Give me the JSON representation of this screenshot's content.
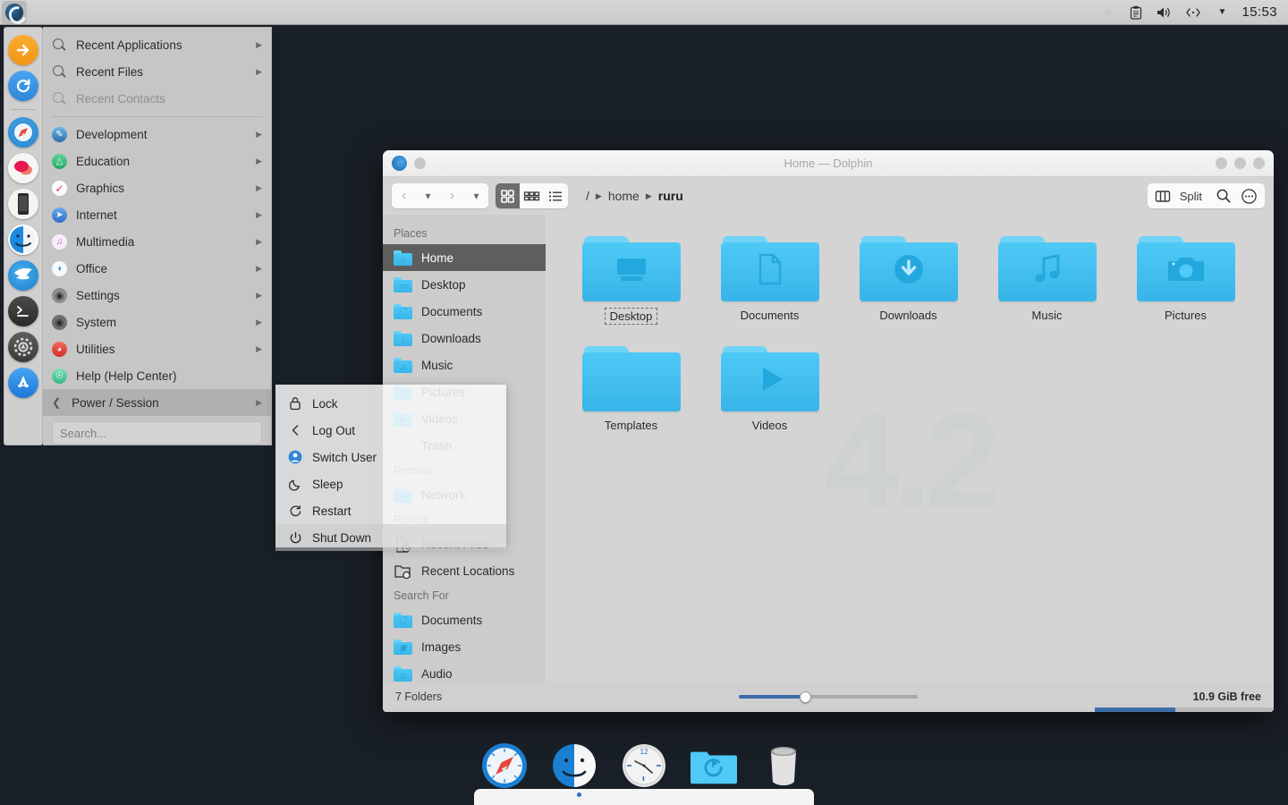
{
  "panel": {
    "launcher_icon": "openmandriva-logo-icon",
    "tray": [
      {
        "name": "bluetooth-disabled-icon",
        "glyph": "○"
      },
      {
        "name": "clipboard-icon",
        "glyph": "📋"
      },
      {
        "name": "volume-icon",
        "glyph": "🔊"
      },
      {
        "name": "network-icon",
        "glyph": "‹··›"
      },
      {
        "name": "show-hidden-icons-icon",
        "glyph": "▼"
      }
    ],
    "clock": "15:53"
  },
  "launcher_strip": {
    "items": [
      {
        "name": "launch-arrow-icon",
        "label": "Run"
      },
      {
        "name": "refresh-icon",
        "label": "Refresh"
      },
      {
        "name": "safari-browser-icon",
        "label": "Browser"
      },
      {
        "name": "messages-icon",
        "label": "Messages"
      },
      {
        "name": "phone-icon",
        "label": "Phone"
      },
      {
        "name": "finder-icon",
        "label": "Files"
      },
      {
        "name": "falkon-icon",
        "label": "Falkon"
      },
      {
        "name": "terminal-icon",
        "label": "Terminal"
      },
      {
        "name": "settings-gear-icon",
        "label": "Settings"
      },
      {
        "name": "app-store-icon",
        "label": "Software"
      }
    ]
  },
  "app_menu": {
    "recent": [
      {
        "label": "Recent Applications",
        "icon": "search-icon",
        "enabled": true,
        "submenu": true
      },
      {
        "label": "Recent Files",
        "icon": "search-icon",
        "enabled": true,
        "submenu": true
      },
      {
        "label": "Recent Contacts",
        "icon": "search-icon",
        "enabled": false,
        "submenu": false
      }
    ],
    "categories": [
      {
        "label": "Development",
        "icon": "development-icon",
        "color": "#3c7fc4",
        "glyph": "✐",
        "submenu": true
      },
      {
        "label": "Education",
        "icon": "education-icon",
        "color": "#3cb878",
        "glyph": "🎓",
        "submenu": true
      },
      {
        "label": "Graphics",
        "icon": "graphics-icon",
        "color": "#ffffff",
        "glyph": "✓",
        "submenu": true
      },
      {
        "label": "Internet",
        "icon": "internet-icon",
        "color": "#4a90e2",
        "glyph": "➤",
        "submenu": true
      },
      {
        "label": "Multimedia",
        "icon": "multimedia-icon",
        "color": "#f3e9f7",
        "glyph": "♫",
        "submenu": true
      },
      {
        "label": "Office",
        "icon": "office-icon",
        "color": "#ffffff",
        "glyph": "◗",
        "submenu": true
      },
      {
        "label": "Settings",
        "icon": "settings-icon",
        "color": "#6e6e6e",
        "glyph": "◎",
        "submenu": true
      },
      {
        "label": "System",
        "icon": "system-icon",
        "color": "#5a5a5a",
        "glyph": "◎",
        "submenu": true
      },
      {
        "label": "Utilities",
        "icon": "utilities-icon",
        "color": "#e8453c",
        "glyph": "⌕",
        "submenu": true
      },
      {
        "label": "Help (Help Center)",
        "icon": "help-icon",
        "color": "#4ecb9a",
        "glyph": "?",
        "submenu": false
      },
      {
        "label": "Power / Session",
        "icon": "power-session-icon",
        "color": "#777777",
        "glyph": "⏻",
        "submenu": true,
        "selected": true,
        "back": true
      }
    ],
    "search_placeholder": "Search..."
  },
  "power_submenu": {
    "items": [
      {
        "label": "Lock",
        "icon": "padlock-icon",
        "glyph": "🔒",
        "selected": false
      },
      {
        "label": "Log Out",
        "icon": "logout-chevron-icon",
        "glyph": "‹",
        "selected": false
      },
      {
        "label": "Switch User",
        "icon": "switch-user-icon",
        "glyph": "👤",
        "selected": false
      },
      {
        "label": "Sleep",
        "icon": "moon-sleep-icon",
        "glyph": "☽",
        "selected": false
      },
      {
        "label": "Restart",
        "icon": "restart-icon",
        "glyph": "↺",
        "selected": false
      },
      {
        "label": "Shut Down",
        "icon": "power-icon",
        "glyph": "⏻",
        "selected": true
      }
    ]
  },
  "dolphin": {
    "title": "Home — Dolphin",
    "window_controls": [
      "minimize",
      "maximize",
      "close"
    ],
    "toolbar": {
      "back_label": "‹",
      "back_menu_label": "▾",
      "forward_label": "›",
      "forward_menu_label": "▾",
      "view_icons_label": "▦",
      "view_compact_label": "▤",
      "view_details_label": "☰",
      "split_label": "Split",
      "search_label": "🔍",
      "menu_label": "⋯"
    },
    "breadcrumb": {
      "root": "/",
      "parts": [
        "home",
        "ruru"
      ]
    },
    "places": {
      "sections": [
        {
          "header": "Places",
          "items": [
            {
              "label": "Home",
              "icon": "folder-home-icon",
              "glyph": "⌂",
              "selected": true
            },
            {
              "label": "Desktop",
              "icon": "folder-desktop-icon",
              "glyph": "▭",
              "selected": false
            },
            {
              "label": "Documents",
              "icon": "folder-documents-icon",
              "glyph": "☰",
              "selected": false
            },
            {
              "label": "Downloads",
              "icon": "folder-downloads-icon",
              "glyph": "↓",
              "selected": false
            },
            {
              "label": "Music",
              "icon": "folder-music-icon",
              "glyph": "♫",
              "selected": false
            },
            {
              "label": "Pictures",
              "icon": "folder-pictures-icon",
              "glyph": "▣",
              "selected": false
            },
            {
              "label": "Videos",
              "icon": "folder-videos-icon",
              "glyph": "▶",
              "selected": false
            },
            {
              "label": "Trash",
              "icon": "trash-icon",
              "glyph": "🗑",
              "selected": false
            }
          ]
        },
        {
          "header": "Remote",
          "items": [
            {
              "label": "Network",
              "icon": "folder-network-icon",
              "glyph": "☁",
              "selected": false
            }
          ]
        },
        {
          "header": "Recent",
          "items": [
            {
              "label": "Recent Files",
              "icon": "recent-files-icon",
              "glyph": "⏱",
              "selected": false
            },
            {
              "label": "Recent Locations",
              "icon": "recent-locations-icon",
              "glyph": "⏱",
              "selected": false
            }
          ]
        },
        {
          "header": "Search For",
          "items": [
            {
              "label": "Documents",
              "icon": "search-documents-icon",
              "glyph": "☰",
              "selected": false
            },
            {
              "label": "Images",
              "icon": "search-images-icon",
              "glyph": "▣",
              "selected": false
            },
            {
              "label": "Audio",
              "icon": "search-audio-icon",
              "glyph": "♫",
              "selected": false
            }
          ]
        }
      ]
    },
    "files": [
      {
        "name": "Desktop",
        "icon": "folder-desktop-icon",
        "glyph": "desktop",
        "focused": true
      },
      {
        "name": "Documents",
        "icon": "folder-documents-icon",
        "glyph": "document",
        "focused": false
      },
      {
        "name": "Downloads",
        "icon": "folder-downloads-icon",
        "glyph": "download",
        "focused": false
      },
      {
        "name": "Music",
        "icon": "folder-music-icon",
        "glyph": "music",
        "focused": false
      },
      {
        "name": "Pictures",
        "icon": "folder-pictures-icon",
        "glyph": "camera",
        "focused": false
      },
      {
        "name": "Templates",
        "icon": "folder-plain-icon",
        "glyph": "plain",
        "focused": false
      },
      {
        "name": "Videos",
        "icon": "folder-videos-icon",
        "glyph": "play",
        "focused": false
      }
    ],
    "watermark": {
      "number": "4.2",
      "name": "OPENMANDRIVA"
    },
    "statusbar": {
      "item_count": "7 Folders",
      "free_space": "10.9 GiB free",
      "zoom_value": 36,
      "free_bar_percent": 45
    }
  },
  "dock": {
    "items": [
      {
        "name": "safari-browser-icon",
        "label": "Browser"
      },
      {
        "name": "finder-icon",
        "label": "Files"
      },
      {
        "name": "clock-icon",
        "label": "Clock"
      },
      {
        "name": "backup-folder-icon",
        "label": "Backups"
      },
      {
        "name": "trash-icon",
        "label": "Trash"
      }
    ]
  },
  "colors": {
    "desktop": "#191f26",
    "accent": "#3d6ca8",
    "folder_blue": "#4fc9f6",
    "panel": "#d0d0d0"
  }
}
